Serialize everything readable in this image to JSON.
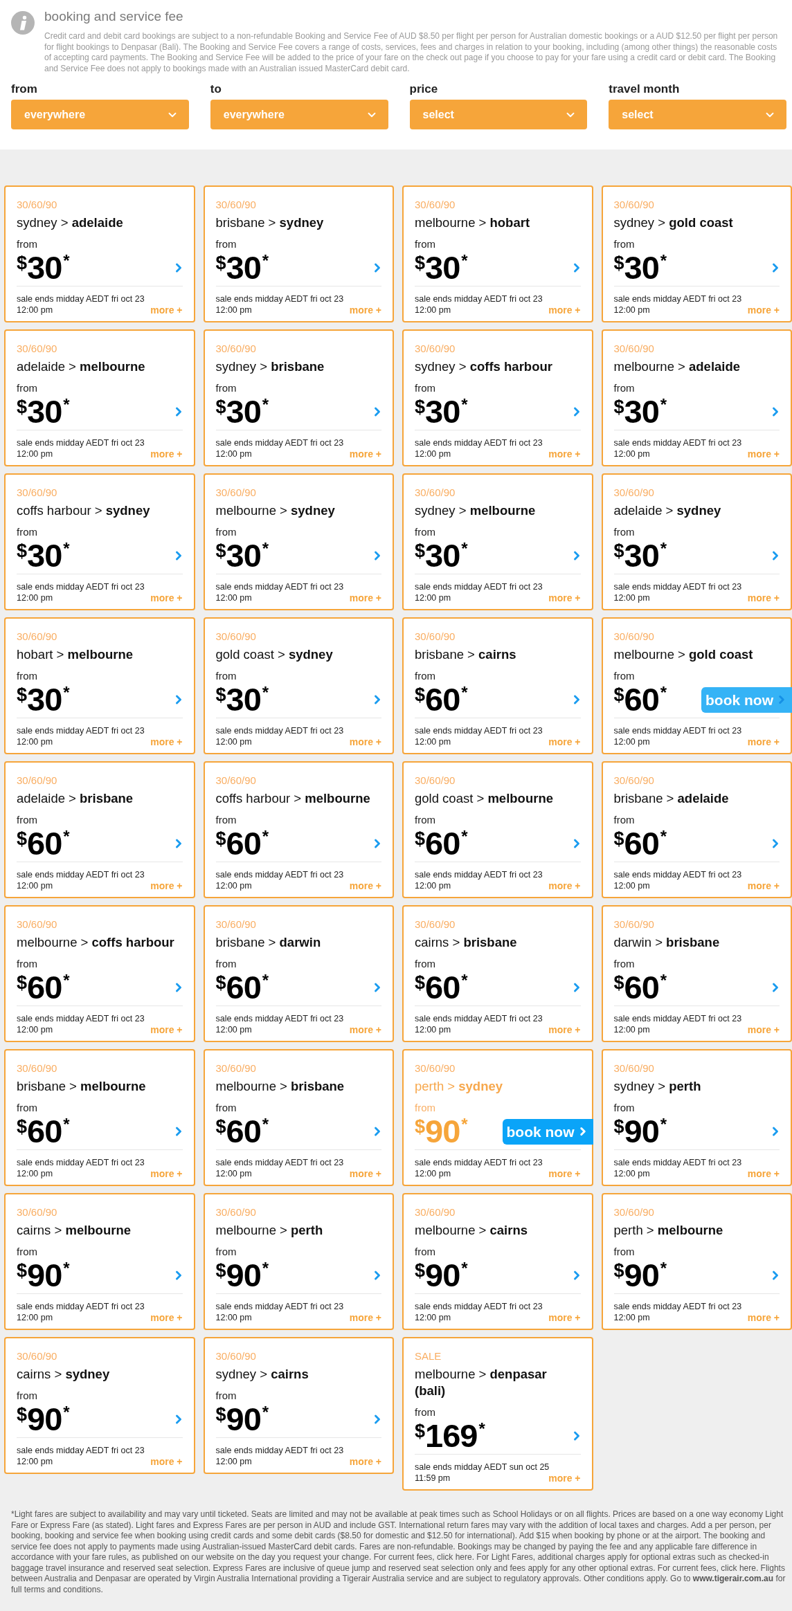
{
  "info": {
    "title": "booking and service fee",
    "text": "Credit card and debit card bookings are subject to a non-refundable Booking and Service Fee of AUD $8.50 per flight per person for Australian domestic bookings or a AUD $12.50 per flight per person for flight bookings to Denpasar (Bali). The Booking and Service Fee covers a range of costs, services, fees and charges in relation to your booking, including (among other things) the reasonable costs of accepting card payments. The Booking and Service Fee will be added to the price of your fare on the check out page if you choose to pay for your fare using a credit card or debit card. The Booking and Service Fee does not apply to bookings made with an Australian issued MasterCard debit card."
  },
  "filters": [
    {
      "label": "from",
      "value": "everywhere"
    },
    {
      "label": "to",
      "value": "everywhere"
    },
    {
      "label": "price",
      "value": "select"
    },
    {
      "label": "travel month",
      "value": "select"
    }
  ],
  "fares": [
    {
      "tag": "30/60/90",
      "route": "sydney > **adelaide**",
      "from_label": "from",
      "currency": "$",
      "amount": "30",
      "mark": "*",
      "sale_ends": "sale ends midday AEDT fri oct 23",
      "time": "12:00 pm",
      "more": "more +",
      "highlighted": false
    },
    {
      "tag": "30/60/90",
      "route": "brisbane > **sydney**",
      "from_label": "from",
      "currency": "$",
      "amount": "30",
      "mark": "*",
      "sale_ends": "sale ends midday AEDT fri oct 23",
      "time": "12:00 pm",
      "more": "more +",
      "highlighted": false
    },
    {
      "tag": "30/60/90",
      "route": "melbourne > **hobart**",
      "from_label": "from",
      "currency": "$",
      "amount": "30",
      "mark": "*",
      "sale_ends": "sale ends midday AEDT fri oct 23",
      "time": "12:00 pm",
      "more": "more +",
      "highlighted": false
    },
    {
      "tag": "30/60/90",
      "route": "sydney > **gold coast**",
      "from_label": "from",
      "currency": "$",
      "amount": "30",
      "mark": "*",
      "sale_ends": "sale ends midday AEDT fri oct 23",
      "time": "12:00 pm",
      "more": "more +",
      "highlighted": false
    },
    {
      "tag": "30/60/90",
      "route": "adelaide > **melbourne**",
      "from_label": "from",
      "currency": "$",
      "amount": "30",
      "mark": "*",
      "sale_ends": "sale ends midday AEDT fri oct 23",
      "time": "12:00 pm",
      "more": "more +",
      "highlighted": false
    },
    {
      "tag": "30/60/90",
      "route": "sydney > **brisbane**",
      "from_label": "from",
      "currency": "$",
      "amount": "30",
      "mark": "*",
      "sale_ends": "sale ends midday AEDT fri oct 23",
      "time": "12:00 pm",
      "more": "more +",
      "highlighted": false
    },
    {
      "tag": "30/60/90",
      "route": "sydney > **coffs harbour**",
      "from_label": "from",
      "currency": "$",
      "amount": "30",
      "mark": "*",
      "sale_ends": "sale ends midday AEDT fri oct 23",
      "time": "12:00 pm",
      "more": "more +",
      "highlighted": false
    },
    {
      "tag": "30/60/90",
      "route": "melbourne > **adelaide**",
      "from_label": "from",
      "currency": "$",
      "amount": "30",
      "mark": "*",
      "sale_ends": "sale ends midday AEDT fri oct 23",
      "time": "12:00 pm",
      "more": "more +",
      "highlighted": false
    },
    {
      "tag": "30/60/90",
      "route": "coffs harbour > **sydney**",
      "from_label": "from",
      "currency": "$",
      "amount": "30",
      "mark": "*",
      "sale_ends": "sale ends midday AEDT fri oct 23",
      "time": "12:00 pm",
      "more": "more +",
      "highlighted": false
    },
    {
      "tag": "30/60/90",
      "route": "melbourne > **sydney**",
      "from_label": "from",
      "currency": "$",
      "amount": "30",
      "mark": "*",
      "sale_ends": "sale ends midday AEDT fri oct 23",
      "time": "12:00 pm",
      "more": "more +",
      "highlighted": false
    },
    {
      "tag": "30/60/90",
      "route": "sydney > **melbourne**",
      "from_label": "from",
      "currency": "$",
      "amount": "30",
      "mark": "*",
      "sale_ends": "sale ends midday AEDT fri oct 23",
      "time": "12:00 pm",
      "more": "more +",
      "highlighted": false
    },
    {
      "tag": "30/60/90",
      "route": "adelaide > **sydney**",
      "from_label": "from",
      "currency": "$",
      "amount": "30",
      "mark": "*",
      "sale_ends": "sale ends midday AEDT fri oct 23",
      "time": "12:00 pm",
      "more": "more +",
      "highlighted": false
    },
    {
      "tag": "30/60/90",
      "route": "hobart > **melbourne**",
      "from_label": "from",
      "currency": "$",
      "amount": "30",
      "mark": "*",
      "sale_ends": "sale ends midday AEDT fri oct 23",
      "time": "12:00 pm",
      "more": "more +",
      "highlighted": false
    },
    {
      "tag": "30/60/90",
      "route": "gold coast > **sydney**",
      "from_label": "from",
      "currency": "$",
      "amount": "30",
      "mark": "*",
      "sale_ends": "sale ends midday AEDT fri oct 23",
      "time": "12:00 pm",
      "more": "more +",
      "highlighted": false
    },
    {
      "tag": "30/60/90",
      "route": "brisbane > **cairns**",
      "from_label": "from",
      "currency": "$",
      "amount": "60",
      "mark": "*",
      "sale_ends": "sale ends midday AEDT fri oct 23",
      "time": "12:00 pm",
      "more": "more +",
      "highlighted": false
    },
    {
      "tag": "30/60/90",
      "route": "melbourne > **gold coast**",
      "from_label": "from",
      "currency": "$",
      "amount": "60",
      "mark": "*",
      "sale_ends": "sale ends midday AEDT fri oct 23",
      "time": "12:00 pm",
      "more": "more +",
      "highlighted": false,
      "book_now": {
        "label": "book now",
        "faded": true
      }
    },
    {
      "tag": "30/60/90",
      "route": "adelaide > **brisbane**",
      "from_label": "from",
      "currency": "$",
      "amount": "60",
      "mark": "*",
      "sale_ends": "sale ends midday AEDT fri oct 23",
      "time": "12:00 pm",
      "more": "more +",
      "highlighted": false
    },
    {
      "tag": "30/60/90",
      "route": "coffs harbour > **melbourne**",
      "from_label": "from",
      "currency": "$",
      "amount": "60",
      "mark": "*",
      "sale_ends": "sale ends midday AEDT fri oct 23",
      "time": "12:00 pm",
      "more": "more +",
      "highlighted": false
    },
    {
      "tag": "30/60/90",
      "route": "gold coast > **melbourne**",
      "from_label": "from",
      "currency": "$",
      "amount": "60",
      "mark": "*",
      "sale_ends": "sale ends midday AEDT fri oct 23",
      "time": "12:00 pm",
      "more": "more +",
      "highlighted": false
    },
    {
      "tag": "30/60/90",
      "route": "brisbane > **adelaide**",
      "from_label": "from",
      "currency": "$",
      "amount": "60",
      "mark": "*",
      "sale_ends": "sale ends midday AEDT fri oct 23",
      "time": "12:00 pm",
      "more": "more +",
      "highlighted": false
    },
    {
      "tag": "30/60/90",
      "route": "melbourne > **coffs harbour**",
      "from_label": "from",
      "currency": "$",
      "amount": "60",
      "mark": "*",
      "sale_ends": "sale ends midday AEDT fri oct 23",
      "time": "12:00 pm",
      "more": "more +",
      "highlighted": false
    },
    {
      "tag": "30/60/90",
      "route": "brisbane > **darwin**",
      "from_label": "from",
      "currency": "$",
      "amount": "60",
      "mark": "*",
      "sale_ends": "sale ends midday AEDT fri oct 23",
      "time": "12:00 pm",
      "more": "more +",
      "highlighted": false
    },
    {
      "tag": "30/60/90",
      "route": "cairns > **brisbane**",
      "from_label": "from",
      "currency": "$",
      "amount": "60",
      "mark": "*",
      "sale_ends": "sale ends midday AEDT fri oct 23",
      "time": "12:00 pm",
      "more": "more +",
      "highlighted": false
    },
    {
      "tag": "30/60/90",
      "route": "darwin > **brisbane**",
      "from_label": "from",
      "currency": "$",
      "amount": "60",
      "mark": "*",
      "sale_ends": "sale ends midday AEDT fri oct 23",
      "time": "12:00 pm",
      "more": "more +",
      "highlighted": false
    },
    {
      "tag": "30/60/90",
      "route": "brisbane > **melbourne**",
      "from_label": "from",
      "currency": "$",
      "amount": "60",
      "mark": "*",
      "sale_ends": "sale ends midday AEDT fri oct 23",
      "time": "12:00 pm",
      "more": "more +",
      "highlighted": false
    },
    {
      "tag": "30/60/90",
      "route": "melbourne > **brisbane**",
      "from_label": "from",
      "currency": "$",
      "amount": "60",
      "mark": "*",
      "sale_ends": "sale ends midday AEDT fri oct 23",
      "time": "12:00 pm",
      "more": "more +",
      "highlighted": false
    },
    {
      "tag": "30/60/90",
      "route": "perth > **sydney**",
      "from_label": "from",
      "currency": "$",
      "amount": "90",
      "mark": "*",
      "sale_ends": "sale ends midday AEDT fri oct 23",
      "time": "12:00 pm",
      "more": "more +",
      "highlighted": true,
      "book_now": {
        "label": "book now",
        "faded": false
      }
    },
    {
      "tag": "30/60/90",
      "route": "sydney > **perth**",
      "from_label": "from",
      "currency": "$",
      "amount": "90",
      "mark": "*",
      "sale_ends": "sale ends midday AEDT fri oct 23",
      "time": "12:00 pm",
      "more": "more +",
      "highlighted": false
    },
    {
      "tag": "30/60/90",
      "route": "cairns > **melbourne**",
      "from_label": "from",
      "currency": "$",
      "amount": "90",
      "mark": "*",
      "sale_ends": "sale ends midday AEDT fri oct 23",
      "time": "12:00 pm",
      "more": "more +",
      "highlighted": false
    },
    {
      "tag": "30/60/90",
      "route": "melbourne > **perth**",
      "from_label": "from",
      "currency": "$",
      "amount": "90",
      "mark": "*",
      "sale_ends": "sale ends midday AEDT fri oct 23",
      "time": "12:00 pm",
      "more": "more +",
      "highlighted": false
    },
    {
      "tag": "30/60/90",
      "route": "melbourne > **cairns**",
      "from_label": "from",
      "currency": "$",
      "amount": "90",
      "mark": "*",
      "sale_ends": "sale ends midday AEDT fri oct 23",
      "time": "12:00 pm",
      "more": "more +",
      "highlighted": false
    },
    {
      "tag": "30/60/90",
      "route": "perth > **melbourne**",
      "from_label": "from",
      "currency": "$",
      "amount": "90",
      "mark": "*",
      "sale_ends": "sale ends midday AEDT fri oct 23",
      "time": "12:00 pm",
      "more": "more +",
      "highlighted": false
    },
    {
      "tag": "30/60/90",
      "route": "cairns > **sydney**",
      "from_label": "from",
      "currency": "$",
      "amount": "90",
      "mark": "*",
      "sale_ends": "sale ends midday AEDT fri oct 23",
      "time": "12:00 pm",
      "more": "more +",
      "highlighted": false
    },
    {
      "tag": "30/60/90",
      "route": "sydney > **cairns**",
      "from_label": "from",
      "currency": "$",
      "amount": "90",
      "mark": "*",
      "sale_ends": "sale ends midday AEDT fri oct 23",
      "time": "12:00 pm",
      "more": "more +",
      "highlighted": false
    },
    {
      "tag": "SALE",
      "route": "melbourne > **denpasar (bali)**",
      "from_label": "from",
      "currency": "$",
      "amount": "169",
      "mark": "*",
      "sale_ends": "sale ends midday AEDT sun oct 25",
      "time": "11:59 pm",
      "more": "more +",
      "highlighted": false
    }
  ],
  "footnote": "*Light fares are subject to availability and may vary until ticketed. Seats are limited and may not be available at peak times such as School Holidays or on all flights. Prices are based on a one way economy Light Fare or Express Fare (as stated). Light fares and Express Fares are per person in AUD and include GST. International return fares may vary with the addition of local taxes and charges. Add a per person, per booking, booking and service fee when booking using credit cards and some debit cards ($8.50 for domestic and $12.50 for international). Add $15 when booking by phone or at the airport. The booking and service fee does not apply to payments made using Australian-issued MasterCard debit cards. Fares are non-refundable. Bookings may be changed by paying the fee and any applicable fare difference in accordance with your fare rules, as published on our website on the day you request your change. For current fees, click here. For Light Fares, additional charges apply for optional extras such as checked-in baggage travel insurance and reserved seat selection. Express Fares are inclusive of queue jump and reserved seat selection only and fees apply for any other optional extras. For current fees, click here. Flights between Australia and Denpasar are operated by Virgin Australia International providing a Tigerair Australia service and are subject to regulatory approvals. Other conditions apply. Go to **www.tigerair.com.au** for full terms and conditions."
}
